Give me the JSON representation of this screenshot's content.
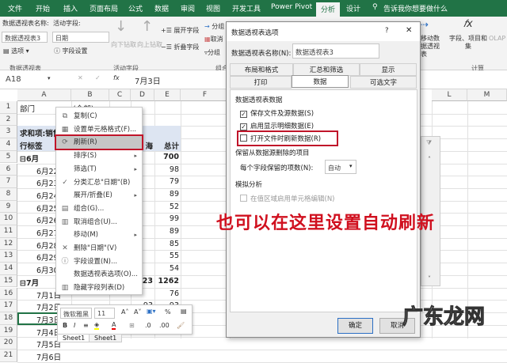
{
  "ribbon_tabs": [
    "文件",
    "开始",
    "插入",
    "页面布局",
    "公式",
    "数据",
    "审阅",
    "视图",
    "开发工具",
    "Power Pivot",
    "分析",
    "设计"
  ],
  "search": "告诉我你想要做什么",
  "ribbon": {
    "pt_name_label": "数据透视表名称:",
    "pt_name": "数据透视表3",
    "options": "选项",
    "group_pt": "数据透视表",
    "active_field_label": "活动字段:",
    "active_field": "日期",
    "field_settings": "字段设置",
    "drill_down": "向下钻取",
    "drill_up": "向上钻取",
    "expand": "展开字段",
    "collapse": "折叠字段",
    "group_af": "活动字段",
    "group_sel": "分组",
    "ungroup": "取消",
    "group_field": "分组",
    "group_grp": "组合",
    "move_pt": "移动数据透视表",
    "fields_items": "字段、项目和集",
    "olap": "OLAP",
    "group_calc": "计算"
  },
  "formula_bar": {
    "name_box": "A18",
    "value": "7月3日"
  },
  "columns": [
    "A",
    "B",
    "C",
    "D",
    "E",
    "F",
    "L",
    "M"
  ],
  "rows": [
    {
      "n": "1",
      "a": "部门",
      "b": "(全部)",
      "d": "",
      "e": ""
    },
    {
      "n": "2",
      "a": "",
      "b": "",
      "d": "",
      "e": ""
    },
    {
      "n": "3",
      "a": "求和项:销售",
      "b": "",
      "d": "",
      "e": ""
    },
    {
      "n": "4",
      "a": "行标签",
      "b": "",
      "d": "海",
      "e": "总计"
    },
    {
      "n": "5",
      "a": "⊟6月",
      "b": "",
      "d": "",
      "e": "700"
    },
    {
      "n": "6",
      "a": "6月22日",
      "b": "",
      "d": "",
      "e": "98"
    },
    {
      "n": "7",
      "a": "6月23日",
      "b": "",
      "d": "",
      "e": "79"
    },
    {
      "n": "8",
      "a": "6月24日",
      "b": "",
      "d": "",
      "e": "89"
    },
    {
      "n": "9",
      "a": "6月25日",
      "b": "",
      "d": "",
      "e": "52"
    },
    {
      "n": "10",
      "a": "6月26日",
      "b": "",
      "d": "",
      "e": "99"
    },
    {
      "n": "11",
      "a": "6月27日",
      "b": "",
      "d": "",
      "e": "89"
    },
    {
      "n": "12",
      "a": "6月28日",
      "b": "",
      "d": "",
      "e": "85"
    },
    {
      "n": "13",
      "a": "6月29日",
      "b": "",
      "d": "",
      "e": "55"
    },
    {
      "n": "14",
      "a": "6月30日",
      "b": "",
      "d": "",
      "e": "54"
    },
    {
      "n": "15",
      "a": "⊟7月",
      "b": "",
      "d": "1223",
      "e": "1262"
    },
    {
      "n": "16",
      "a": "7月1日",
      "b": "",
      "d": "",
      "e": "76"
    },
    {
      "n": "17",
      "a": "7月2日",
      "b": "",
      "d": "93",
      "e": "93"
    },
    {
      "n": "18",
      "a": "7月3日",
      "b": "",
      "d": "90",
      "e": "90"
    },
    {
      "n": "19",
      "a": "7月4日",
      "b": "",
      "d": "",
      "e": ""
    },
    {
      "n": "20",
      "a": "7月5日",
      "b": "",
      "d": "",
      "e": ""
    },
    {
      "n": "21",
      "a": "7月6日",
      "b": "",
      "d": "",
      "e": ""
    }
  ],
  "context_menu": [
    {
      "label": "复制(C)",
      "icon": "copy-icon",
      "glyph": "⧉",
      "arrow": ""
    },
    {
      "label": "设置单元格格式(F)...",
      "icon": "format-cells-icon",
      "glyph": "▦",
      "arrow": ""
    },
    {
      "label": "刷新(R)",
      "icon": "refresh-icon",
      "glyph": "⟳",
      "arrow": ""
    },
    {
      "label": "排序(S)",
      "icon": "",
      "glyph": "",
      "arrow": "▸"
    },
    {
      "label": "筛选(T)",
      "icon": "",
      "glyph": "",
      "arrow": "▸"
    },
    {
      "label": "分类汇总\"日期\"(B)",
      "icon": "check-icon",
      "glyph": "✓",
      "arrow": ""
    },
    {
      "label": "展开/折叠(E)",
      "icon": "",
      "glyph": "",
      "arrow": "▸"
    },
    {
      "label": "组合(G)...",
      "icon": "group-icon",
      "glyph": "▤",
      "arrow": ""
    },
    {
      "label": "取消组合(U)...",
      "icon": "ungroup-icon",
      "glyph": "▥",
      "arrow": ""
    },
    {
      "label": "移动(M)",
      "icon": "",
      "glyph": "",
      "arrow": "▸"
    },
    {
      "label": "删除\"日期\"(V)",
      "icon": "delete-icon",
      "glyph": "✕",
      "arrow": ""
    },
    {
      "label": "字段设置(N)...",
      "icon": "field-settings-icon",
      "glyph": "ⓘ",
      "arrow": ""
    },
    {
      "label": "数据透视表选项(O)...",
      "icon": "",
      "glyph": "",
      "arrow": ""
    },
    {
      "label": "隐藏字段列表(D)",
      "icon": "field-list-icon",
      "glyph": "▥",
      "arrow": ""
    }
  ],
  "mini_toolbar": {
    "font": "微软雅黑",
    "size": "11",
    "percent": "%",
    "bold": "B",
    "italic": "I"
  },
  "sheet_tabs": [
    "Sheet1",
    "Sheet1"
  ],
  "dialog": {
    "title": "数据透视表选项",
    "help": "?",
    "close": "✕",
    "name_label": "数据透视表名称(N):",
    "name_value": "数据透视表3",
    "tabs_row1": [
      "布局和格式",
      "汇总和筛选",
      "显示"
    ],
    "tabs_row2": [
      "打印",
      "数据",
      "可选文字"
    ],
    "section1": "数据透视表数据",
    "opt_save": "保存文件及源数据(S)",
    "opt_detail": "启用显示明细数据(E)",
    "opt_refresh": "打开文件时刷新数据(R)",
    "section2": "保留从数据源删除的项目",
    "items_label": "每个字段保留的项数(N):",
    "items_value": "自动",
    "section3": "模拟分析",
    "opt_whatif": "在值区域启用单元格编辑(N)",
    "ok": "确定",
    "cancel": "取消"
  },
  "annotation": "也可以在这里设置自动刷新",
  "watermark": "广东龙网"
}
